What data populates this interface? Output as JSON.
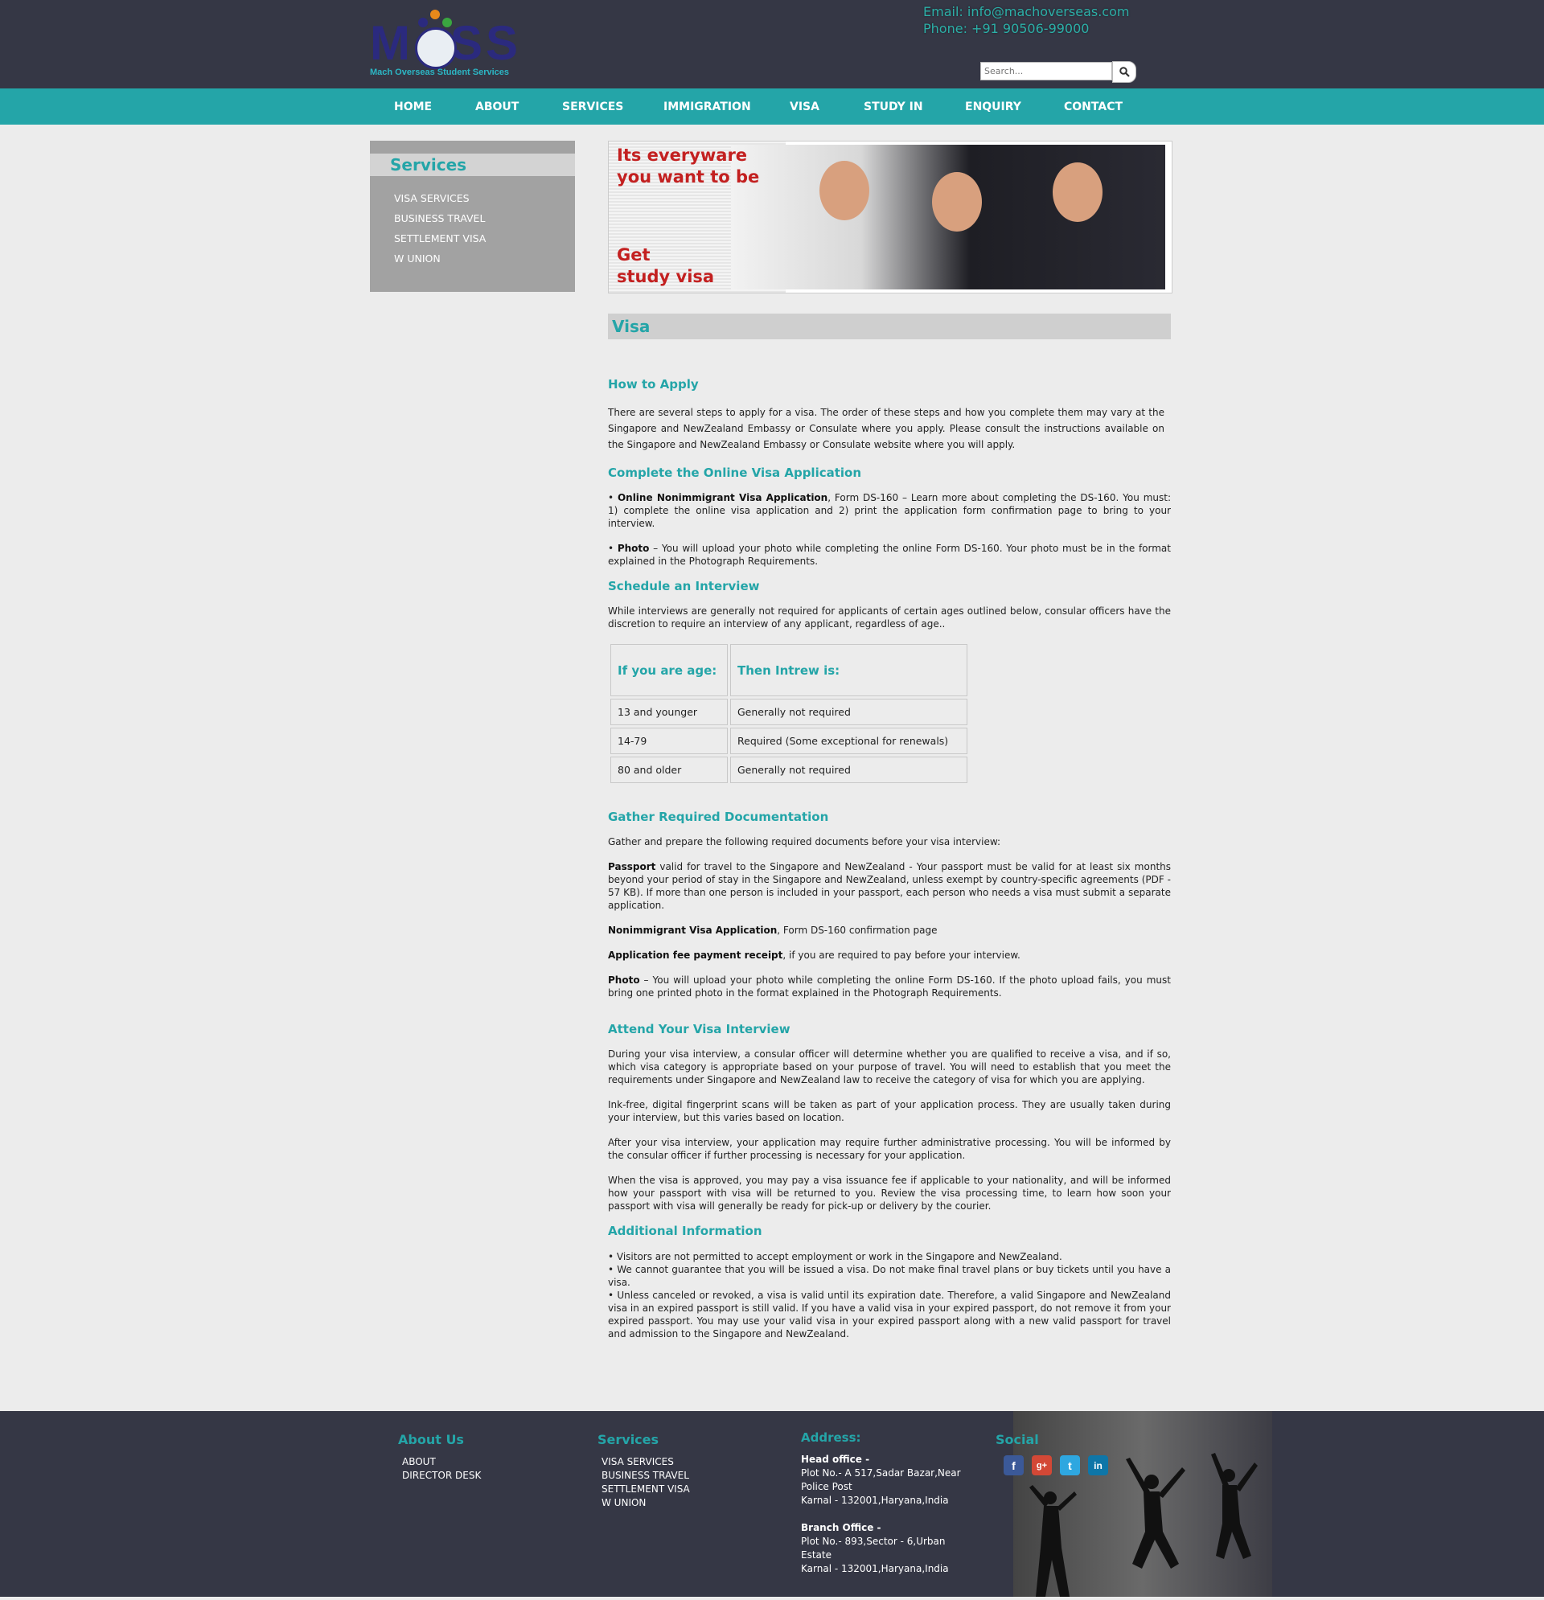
{
  "brand": {
    "logo_text": "MOSS",
    "tagline": "Mach Overseas Student Services"
  },
  "contact": {
    "email": "Email: info@machoverseas.com",
    "phone": "Phone: +91 90506-99000"
  },
  "search": {
    "placeholder": "Search..."
  },
  "nav": [
    "HOME",
    "ABOUT",
    "SERVICES",
    "IMMIGRATION",
    "VISA",
    "STUDY IN",
    "ENQUIRY",
    "CONTACT"
  ],
  "sidebar": {
    "title": "Services",
    "items": [
      "VISA SERVICES",
      "BUSINESS TRAVEL",
      "SETTLEMENT VISA",
      "W UNION"
    ]
  },
  "banner": {
    "line1": "Its everyware",
    "line2": "you want to be",
    "line3": "Get",
    "line4": "study visa"
  },
  "page": {
    "title": "Visa",
    "how_heading": "How to Apply",
    "how_text": "There are several steps to apply for a visa. The order of these steps and how you complete them may vary at the Singapore and NewZealand Embassy or Consulate where you apply. Please consult the instructions available on the Singapore and NewZealand Embassy or Consulate website where you will apply.",
    "online_heading": "Complete the Online Visa Application",
    "online_1_bold": "Online Nonimmigrant Visa Application",
    "online_1_text": ", Form DS-160 – Learn more about completing the DS-160. You must: 1) complete the online visa application and 2) print the application form confirmation page to bring to your interview.",
    "online_2_bold": "Photo",
    "online_2_text": " – You will upload your photo while completing the online Form DS-160. Your photo must be in the format explained in the Photograph Requirements.",
    "schedule_heading": "Schedule an Interview",
    "schedule_text": "While interviews are generally not required for applicants of certain ages outlined below, consular officers have the discretion to require an interview of any applicant, regardless of age..",
    "table": {
      "headers": [
        "If you are age:",
        "Then Intrew is:"
      ],
      "rows": [
        [
          "13 and younger",
          "Generally not required"
        ],
        [
          "14-79",
          "Required (Some exceptional for renewals)"
        ],
        [
          "80 and older",
          "Generally not required"
        ]
      ]
    },
    "gather_heading": "Gather Required Documentation",
    "gather_intro": "Gather and prepare the following required documents before your visa interview:",
    "doc_1_bold": "Passport",
    "doc_1_text": " valid for travel to the Singapore and NewZealand - Your passport must be valid for at least six months beyond your period of stay in the Singapore and NewZealand, unless exempt by country-specific agreements (PDF - 57 KB). If more than one person is included in your passport, each person who needs a visa must submit a separate application.",
    "doc_2_bold": "Nonimmigrant Visa Application",
    "doc_2_text": ", Form DS-160 confirmation page",
    "doc_3_bold": "Application fee payment receipt",
    "doc_3_text": ", if you are required to pay before your interview.",
    "doc_4_bold": "Photo",
    "doc_4_text": " – You will upload your photo while completing the online Form DS-160. If the photo upload fails, you must bring one printed photo in the format explained in the Photograph Requirements.",
    "attend_heading": "Attend Your Visa Interview",
    "attend_1": "During your visa interview, a consular officer will determine whether you are qualified to receive a visa, and if so, which visa category is appropriate based on your purpose of travel. You will need to establish that you meet the requirements under Singapore and NewZealand law to receive the category of visa for which you are applying.",
    "attend_2": "Ink-free, digital fingerprint scans will be taken as part of your application process. They are usually taken during your interview, but this varies based on location.",
    "attend_3": "After your visa interview, your application may require further administrative processing. You will be informed by the consular officer if further processing is necessary for your application.",
    "attend_4": "When the visa is approved, you may pay a visa issuance fee if applicable to your nationality, and will be informed how your passport with visa will be returned to you. Review the visa processing time, to learn how soon your passport with visa will generally be ready for pick-up or delivery by the courier.",
    "additional_heading": "Additional Information",
    "additional_items": [
      "• Visitors are not permitted to accept employment or work in the Singapore and NewZealand.",
      "• We cannot guarantee that you will be issued a visa. Do not make final travel plans or buy tickets until you have a visa.",
      "• Unless canceled or revoked, a visa is valid until its expiration date. Therefore, a valid Singapore and NewZealand visa in an expired passport is still valid. If you have a valid visa in your expired passport, do not remove it from your expired passport. You may use your valid visa in your expired passport along with a new valid passport for travel and admission to the Singapore and NewZealand."
    ]
  },
  "footer": {
    "about_title": "About Us",
    "about_links": [
      "ABOUT",
      "DIRECTOR DESK"
    ],
    "services_title": "Services",
    "services_links": [
      "VISA SERVICES",
      "BUSINESS TRAVEL",
      "SETTLEMENT VISA",
      "W UNION"
    ],
    "address_title": "Address:",
    "head_office_label": "Head office -",
    "head_office_1": "Plot No.- A 517,Sadar Bazar,Near Police Post",
    "head_office_2": "Karnal - 132001,Haryana,India",
    "branch_office_label": "Branch Office -",
    "branch_office_1": "Plot No.- 893,Sector - 6,Urban Estate",
    "branch_office_2": "Karnal - 132001,Haryana,India",
    "social_title": "Social",
    "social": [
      {
        "name": "facebook-icon",
        "glyph": "f",
        "color": "#3b5998"
      },
      {
        "name": "google-plus-icon",
        "glyph": "g+",
        "color": "#d34836"
      },
      {
        "name": "twitter-icon",
        "glyph": "t",
        "color": "#2ea7e0"
      },
      {
        "name": "linkedin-icon",
        "glyph": "in",
        "color": "#0e76a8"
      }
    ]
  },
  "colors": {
    "accent": "#24a5a8",
    "header_bg": "#353745",
    "banner_red": "#c32020"
  }
}
